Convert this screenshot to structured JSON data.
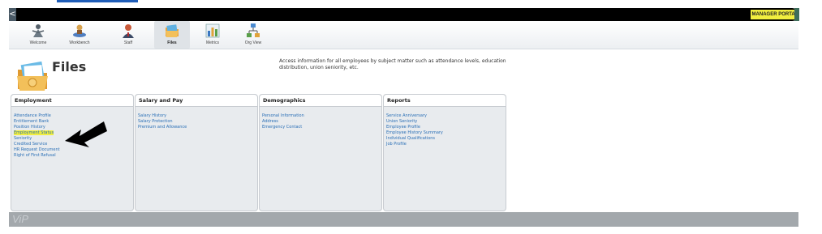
{
  "header": {
    "back_label": "<",
    "portal_badge": "MANAGER PORTAL",
    "colors": {
      "badge": "#f1ee3f",
      "bar": "#000000"
    }
  },
  "nav": {
    "items": [
      {
        "label": "Welcome",
        "icon": "welcome-icon"
      },
      {
        "label": "Workbench",
        "icon": "workbench-icon"
      },
      {
        "label": "Staff",
        "icon": "staff-icon"
      },
      {
        "label": "Files",
        "icon": "files-icon",
        "active": true
      },
      {
        "label": "Metrics",
        "icon": "metrics-icon"
      },
      {
        "label": "Org View",
        "icon": "org-view-icon"
      }
    ]
  },
  "page": {
    "title": "Files",
    "description": "Access information for all employees by subject matter such as attendance levels, education distribution, union seniority, etc."
  },
  "panels": [
    {
      "title": "Employment",
      "links": [
        "Attendance Profile",
        "Entitlement Bank",
        "Position History",
        "Employment Status",
        "Seniority",
        "Credited Service",
        "HR Request Document",
        "Right of First Refusal"
      ],
      "highlighted": "Employment Status"
    },
    {
      "title": "Salary and Pay",
      "links": [
        "Salary History",
        "Salary Protection",
        "Premium and Allowance"
      ]
    },
    {
      "title": "Demographics",
      "links": [
        "Personal Information",
        "Address",
        "Emergency Contact"
      ]
    },
    {
      "title": "Reports",
      "links": [
        "Service Anniversary",
        "Union Seniority",
        "Employee Profile",
        "Employee History Summary",
        "Individual Qualifications",
        "Job Profile"
      ]
    }
  ],
  "footer": {
    "logo": "ViP"
  }
}
